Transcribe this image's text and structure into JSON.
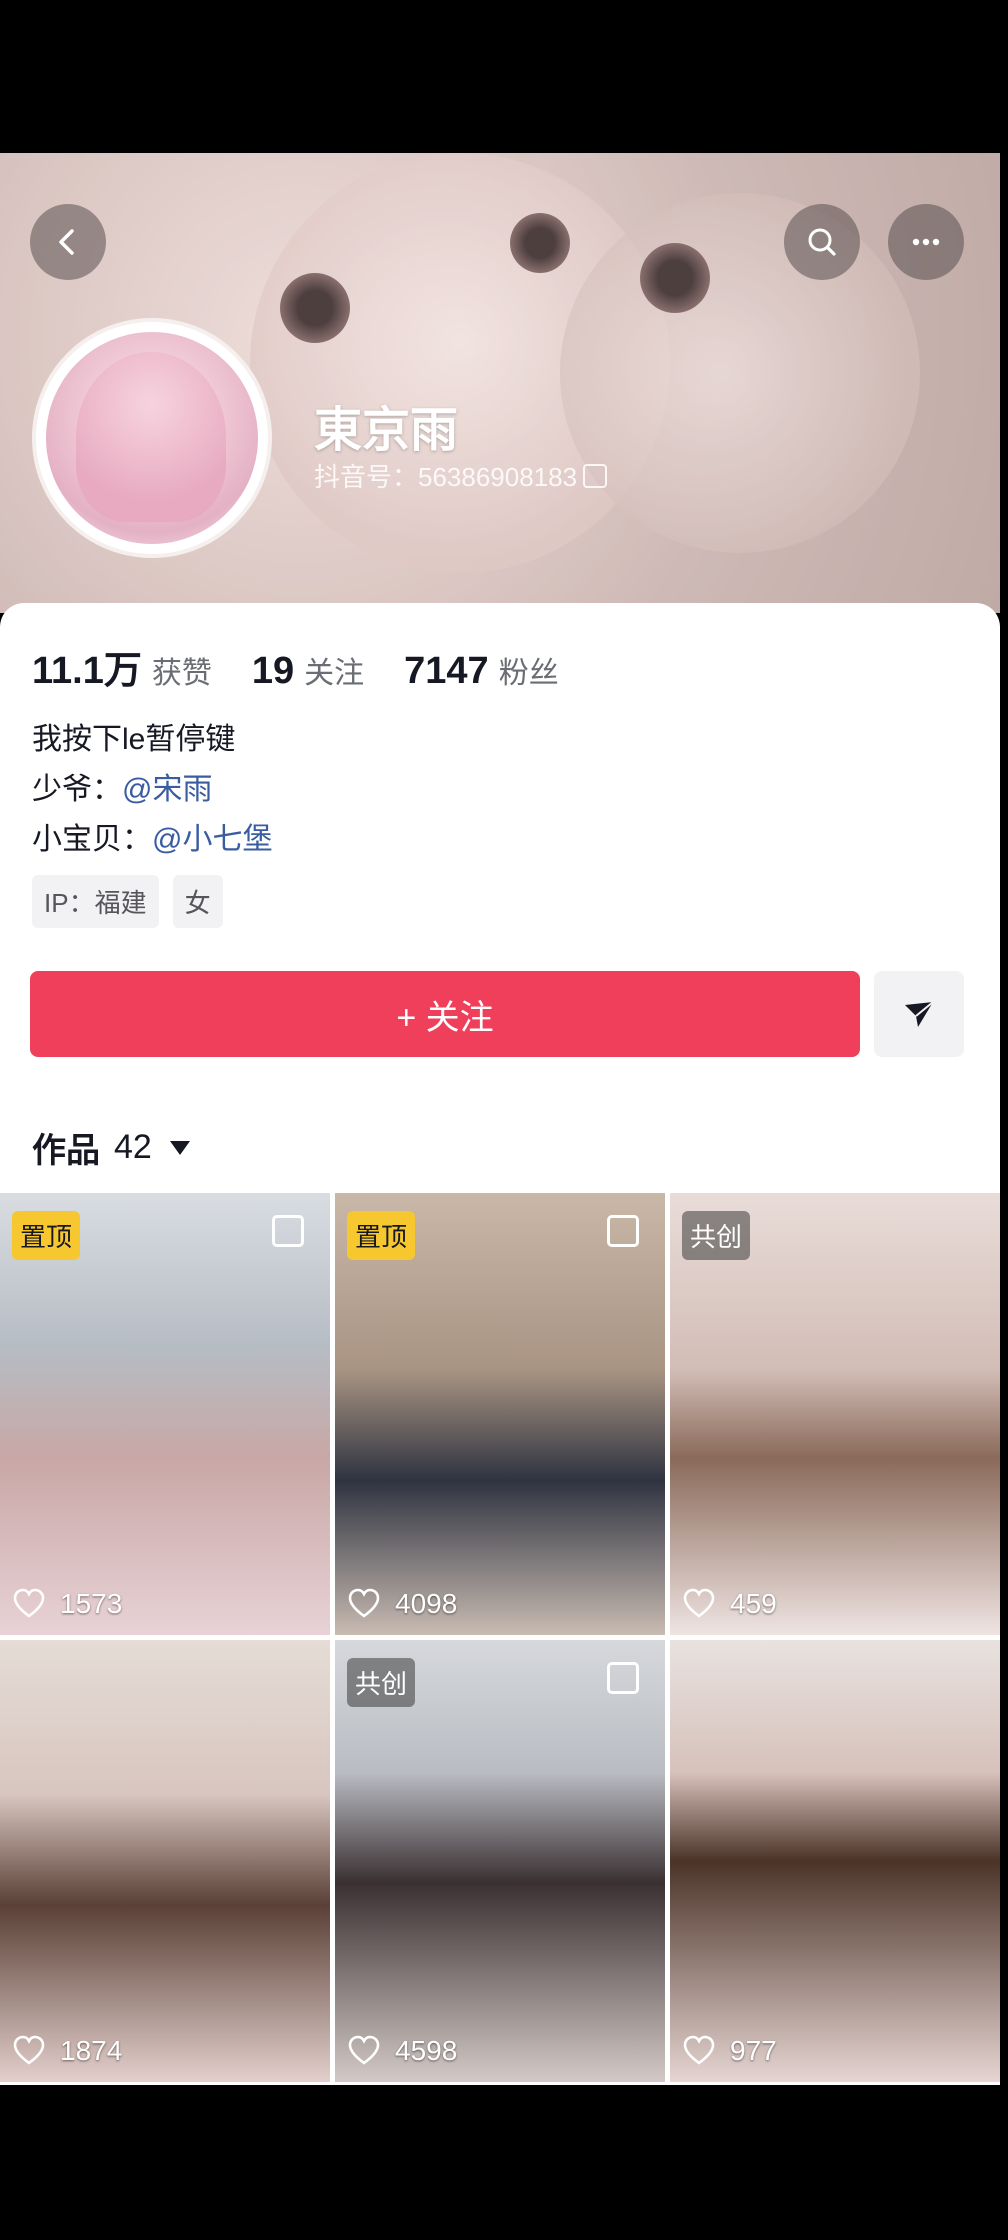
{
  "profile": {
    "name": "東京雨",
    "douyin_id": "抖音号：56386908183"
  },
  "stats": [
    {
      "value": "11.1万",
      "label": "获赞"
    },
    {
      "value": "19",
      "label": "关注"
    },
    {
      "value": "7147",
      "label": "粉丝"
    }
  ],
  "bio": {
    "line1": "我按下le暂停键",
    "line2_prefix": "少爷：",
    "line2_mention": "@宋雨",
    "line3_prefix": "小宝贝：",
    "line3_mention": "@小七堡"
  },
  "tags": [
    "IP：福建",
    "女"
  ],
  "actions": {
    "follow_label": "+ 关注",
    "send_icon": "paper-plane-icon"
  },
  "works": {
    "label": "作品",
    "count": "42"
  },
  "videos": [
    {
      "badge": "置顶",
      "badge_type": "pinned",
      "likes": "1573",
      "multi": true
    },
    {
      "badge": "置顶",
      "badge_type": "pinned",
      "likes": "4098",
      "multi": true
    },
    {
      "badge": "共创",
      "badge_type": "collab",
      "likes": "459",
      "multi": false
    },
    {
      "badge": "",
      "badge_type": "",
      "likes": "1874",
      "multi": false
    },
    {
      "badge": "共创",
      "badge_type": "collab",
      "likes": "4598",
      "multi": true
    },
    {
      "badge": "",
      "badge_type": "",
      "likes": "977",
      "multi": false
    }
  ],
  "colors": {
    "follow": "#ef3f5a",
    "mention": "#3a5da0",
    "pinned_badge": "#f7c730"
  }
}
